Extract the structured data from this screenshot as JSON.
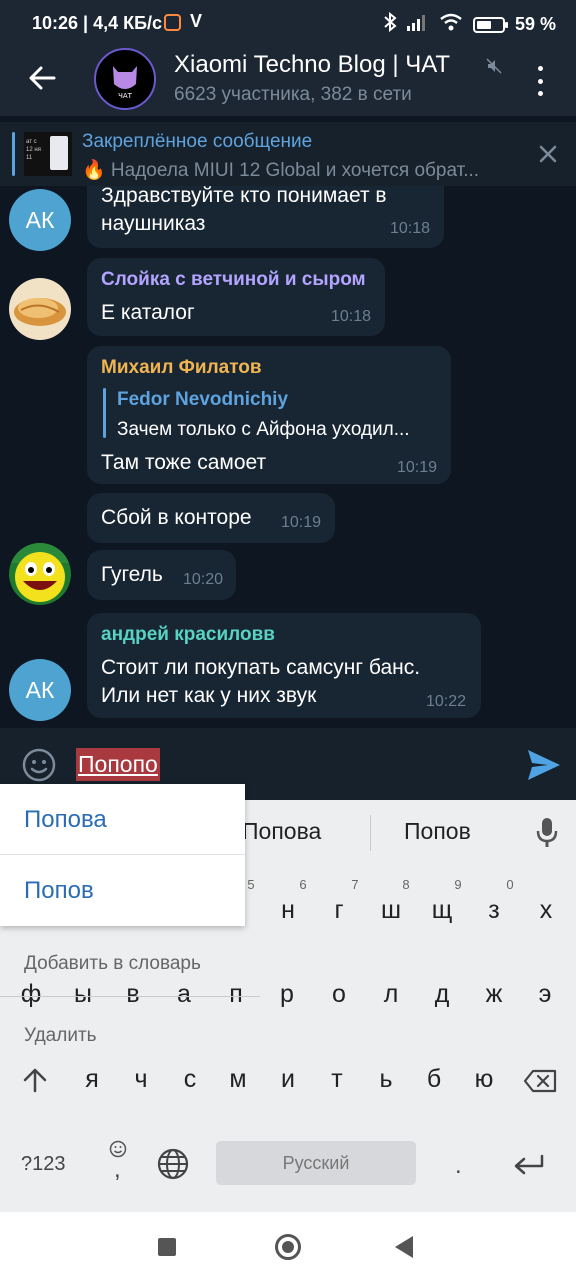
{
  "status_bar": {
    "time": "10:26 | 4,4 КБ/с",
    "v_icon": "V",
    "battery_percent": "59 %",
    "battery_level": 0.59
  },
  "header": {
    "title": "Xiaomi Techno Blog | ЧАТ",
    "subtitle": "6623 участника, 382 в сети",
    "avatar_text": "ЧАТ"
  },
  "pinned": {
    "title": "Закреплённое сообщение",
    "text": "🔥 Надоела MIUI 12 Global и хочется обрат...",
    "thumb_text": "ат с\n12 ня\n11"
  },
  "messages": [
    {
      "avatar": "АК",
      "lines": [
        "Здравствуйте кто понимает в",
        "наушниказ"
      ],
      "time": "10:18"
    },
    {
      "sender": "Слойка с ветчиной и сыром",
      "sender_color": "#b3a4ff",
      "lines": [
        "Е каталог"
      ],
      "time": "10:18"
    },
    {
      "sender": "Михаил Филатов",
      "sender_color": "#f0b450",
      "quote_name": "Fedor Nevodnichiy",
      "quote_text": "Зачем только с Айфона уходил...",
      "lines": [
        "Там тоже самоет"
      ],
      "time": "10:19"
    },
    {
      "lines": [
        "Сбой в конторе"
      ],
      "time": "10:19"
    },
    {
      "lines": [
        "Гугель"
      ],
      "time": "10:20"
    },
    {
      "avatar": "АК",
      "sender": "андрей красиловв",
      "sender_color": "#58d3c3",
      "lines": [
        "Стоит ли покупать самсунг банс.",
        "Или нет как у них звук"
      ],
      "time": "10:22"
    }
  ],
  "input": {
    "value": "Попопо"
  },
  "keyboard": {
    "suggestions": [
      "Попова",
      "Попов"
    ],
    "popup_items": [
      "Попова",
      "Попов"
    ],
    "menu_add": "Добавить в словарь",
    "menu_delete": "Удалить",
    "row1_hints": [
      "5",
      "6",
      "7",
      "8",
      "9",
      "0"
    ],
    "row1_keys": [
      "н",
      "г",
      "ш",
      "щ",
      "з",
      "х"
    ],
    "row2_keys": [
      "ф",
      "ы",
      "в",
      "а",
      "п",
      "р",
      "о",
      "л",
      "д",
      "ж",
      "э"
    ],
    "row3_keys": [
      "я",
      "ч",
      "с",
      "м",
      "и",
      "т",
      "ь",
      "б",
      "ю"
    ],
    "sym_key": "?123",
    "comma_key": ",",
    "space_label": "Русский",
    "period_key": "."
  },
  "colors": {
    "accent": "#5fa3de",
    "bubble": "#182533",
    "background": "#0e1621",
    "header": "#1c2733"
  }
}
